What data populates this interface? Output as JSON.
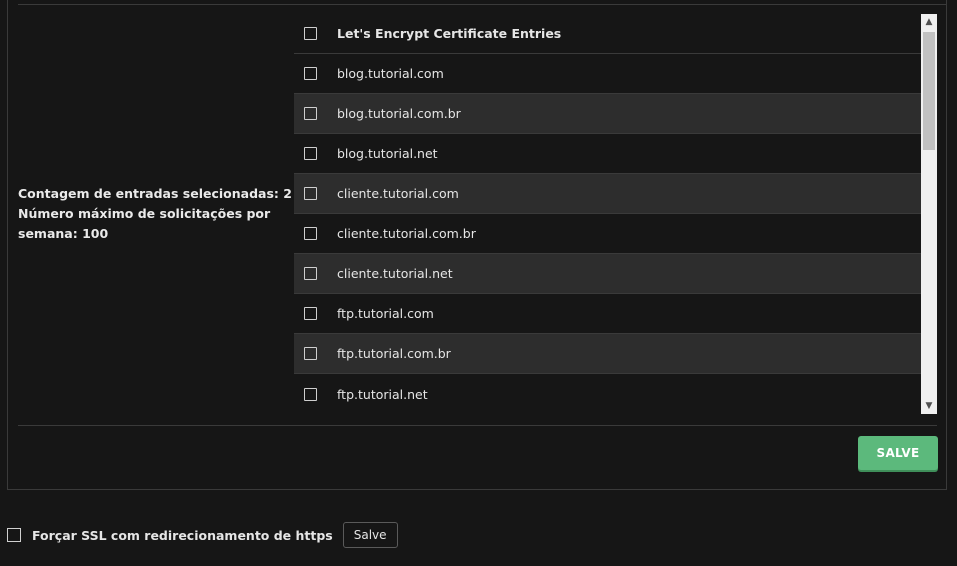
{
  "stats": {
    "selected_count": "Contagem de entradas selecionadas: 2",
    "max_requests": "Número máximo de solicitações por semana: 100"
  },
  "certificate_list": {
    "header": "Let's Encrypt Certificate Entries",
    "entries": [
      "blog.tutorial.com",
      "blog.tutorial.com.br",
      "blog.tutorial.net",
      "cliente.tutorial.com",
      "cliente.tutorial.com.br",
      "cliente.tutorial.net",
      "ftp.tutorial.com",
      "ftp.tutorial.com.br",
      "ftp.tutorial.net"
    ]
  },
  "actions": {
    "save_label": "SALVE"
  },
  "force_ssl": {
    "label": "Forçar SSL com redirecionamento de https",
    "save_label": "Salve"
  },
  "colors": {
    "background": "#161616",
    "row_alt": "#2d2d2d",
    "save_button": "#5cb97c"
  }
}
